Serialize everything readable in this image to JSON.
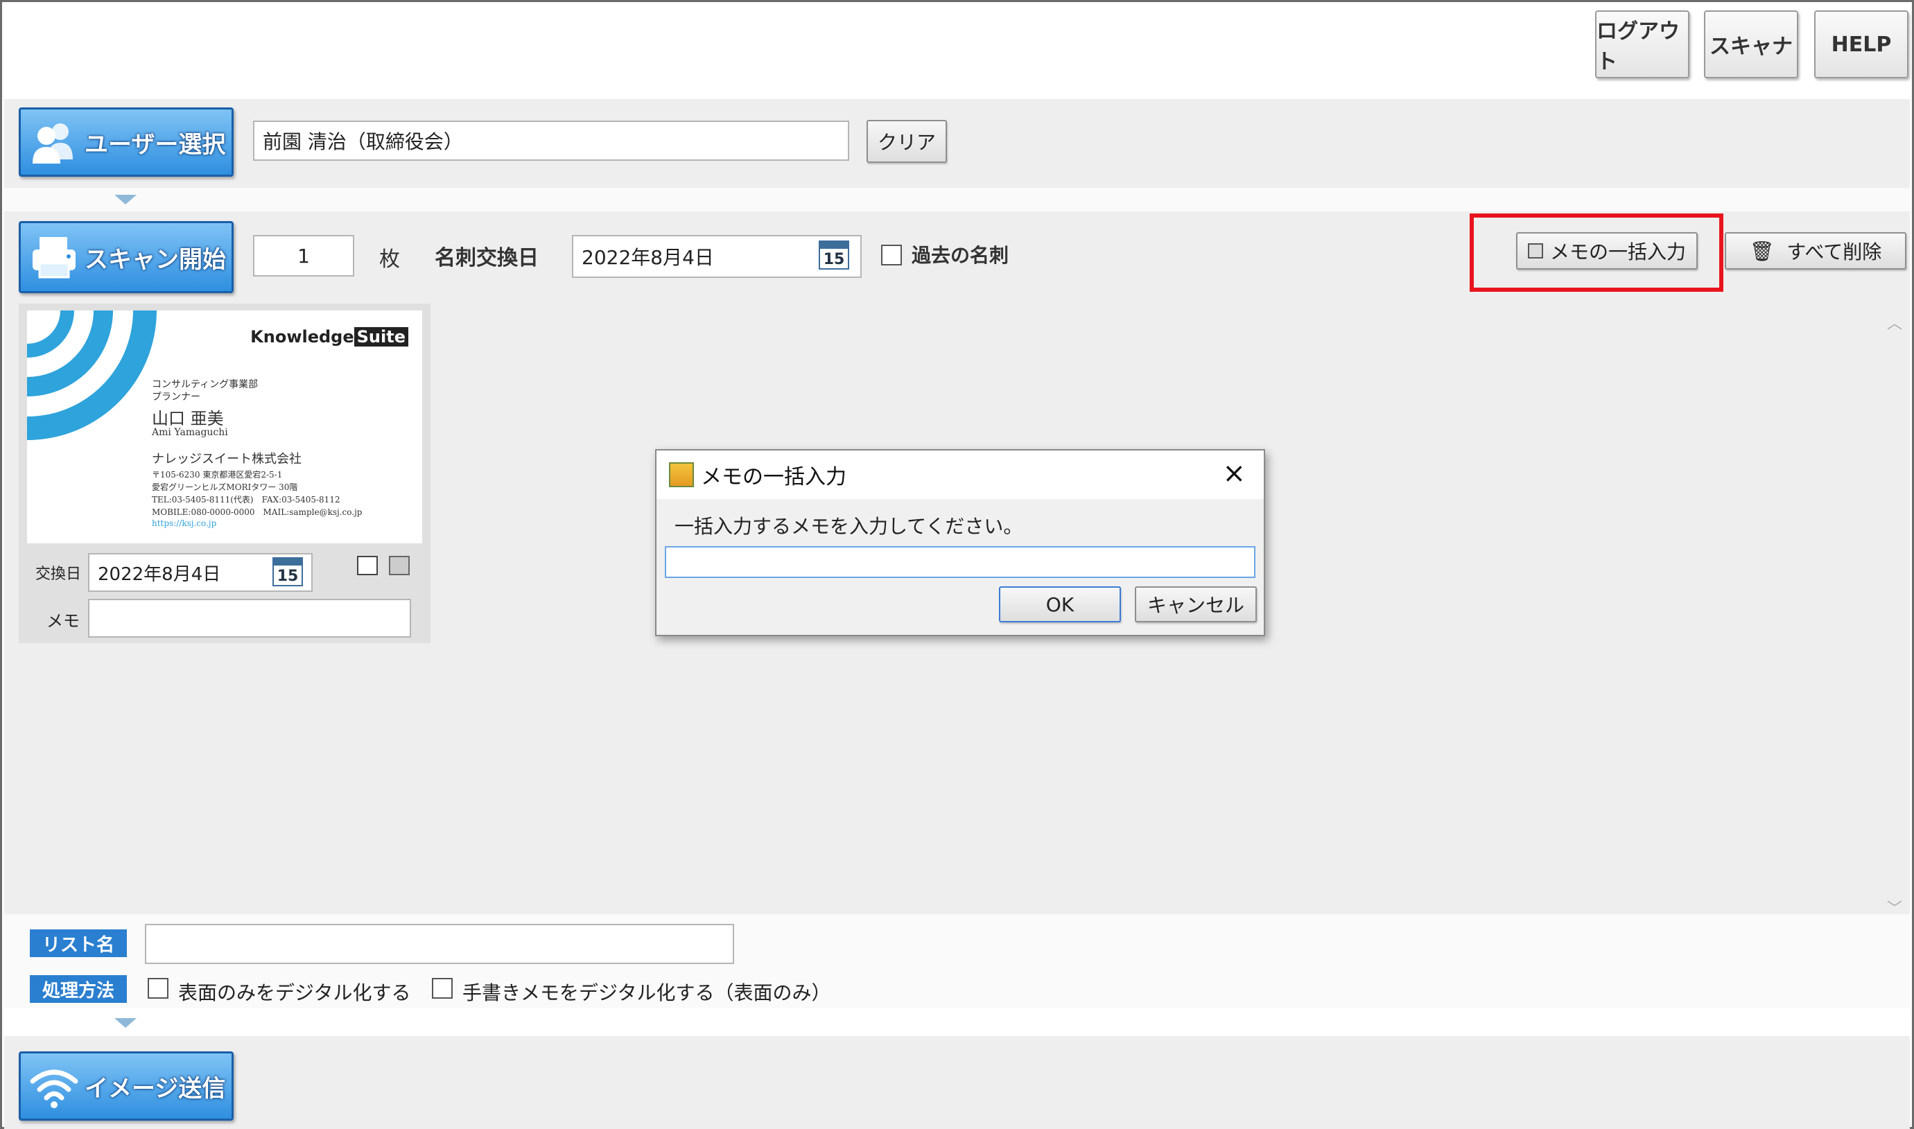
{
  "toolbar": {
    "logout_label": "ログアウト",
    "scanner_label": "スキャナ",
    "help_label": "HELP"
  },
  "user_section": {
    "select_button_label": "ユーザー選択",
    "selected_user_value": "前園 清治（取締役会）",
    "clear_button_label": "クリア"
  },
  "scan_section": {
    "start_button_label": "スキャン開始",
    "count_value": "1",
    "count_unit": "枚",
    "exchange_date_label": "名刺交換日",
    "exchange_date_value": "2022年8月4日",
    "calendar_day": "15",
    "past_cards_label": "過去の名刺",
    "bulk_memo_button_label": "メモの一括入力",
    "delete_all_button_label": "すべて削除"
  },
  "card": {
    "brand": "Knowledge",
    "brand_suffix": "Suite",
    "dept": "コンサルティング事業部",
    "role": "プランナー",
    "name": "山口 亜美",
    "name_roman": "Ami Yamaguchi",
    "company": "ナレッジスイート株式会社",
    "address1": "〒105-6230 東京都港区愛宕2-5-1",
    "address2": "愛宕グリーンヒルズMORIタワー 30階",
    "tel": "TEL:03-5405-8111(代表)　FAX:03-5405-8112",
    "mobile": "MOBILE:080-0000-0000　MAIL:sample@ksj.co.jp",
    "url": "https://ksj.co.jp",
    "exchange_date_label": "交換日",
    "exchange_date_value": "2022年8月4日",
    "calendar_day": "15",
    "memo_label": "メモ",
    "memo_value": ""
  },
  "dialog": {
    "title": "メモの一括入力",
    "message": "一括入力するメモを入力してください。",
    "input_value": "",
    "ok_label": "OK",
    "cancel_label": "キャンセル"
  },
  "bottom": {
    "list_name_tag": "リスト名",
    "list_name_value": "",
    "process_tag": "処理方法",
    "option_front_only": "表面のみをデジタル化する",
    "option_handwritten": "手書きメモをデジタル化する（表面のみ）",
    "send_button_label": "イメージ送信"
  },
  "colors": {
    "highlight": "#e8141c",
    "button_blue": "#2f8fe0",
    "tag_blue": "#2a7fd0"
  }
}
